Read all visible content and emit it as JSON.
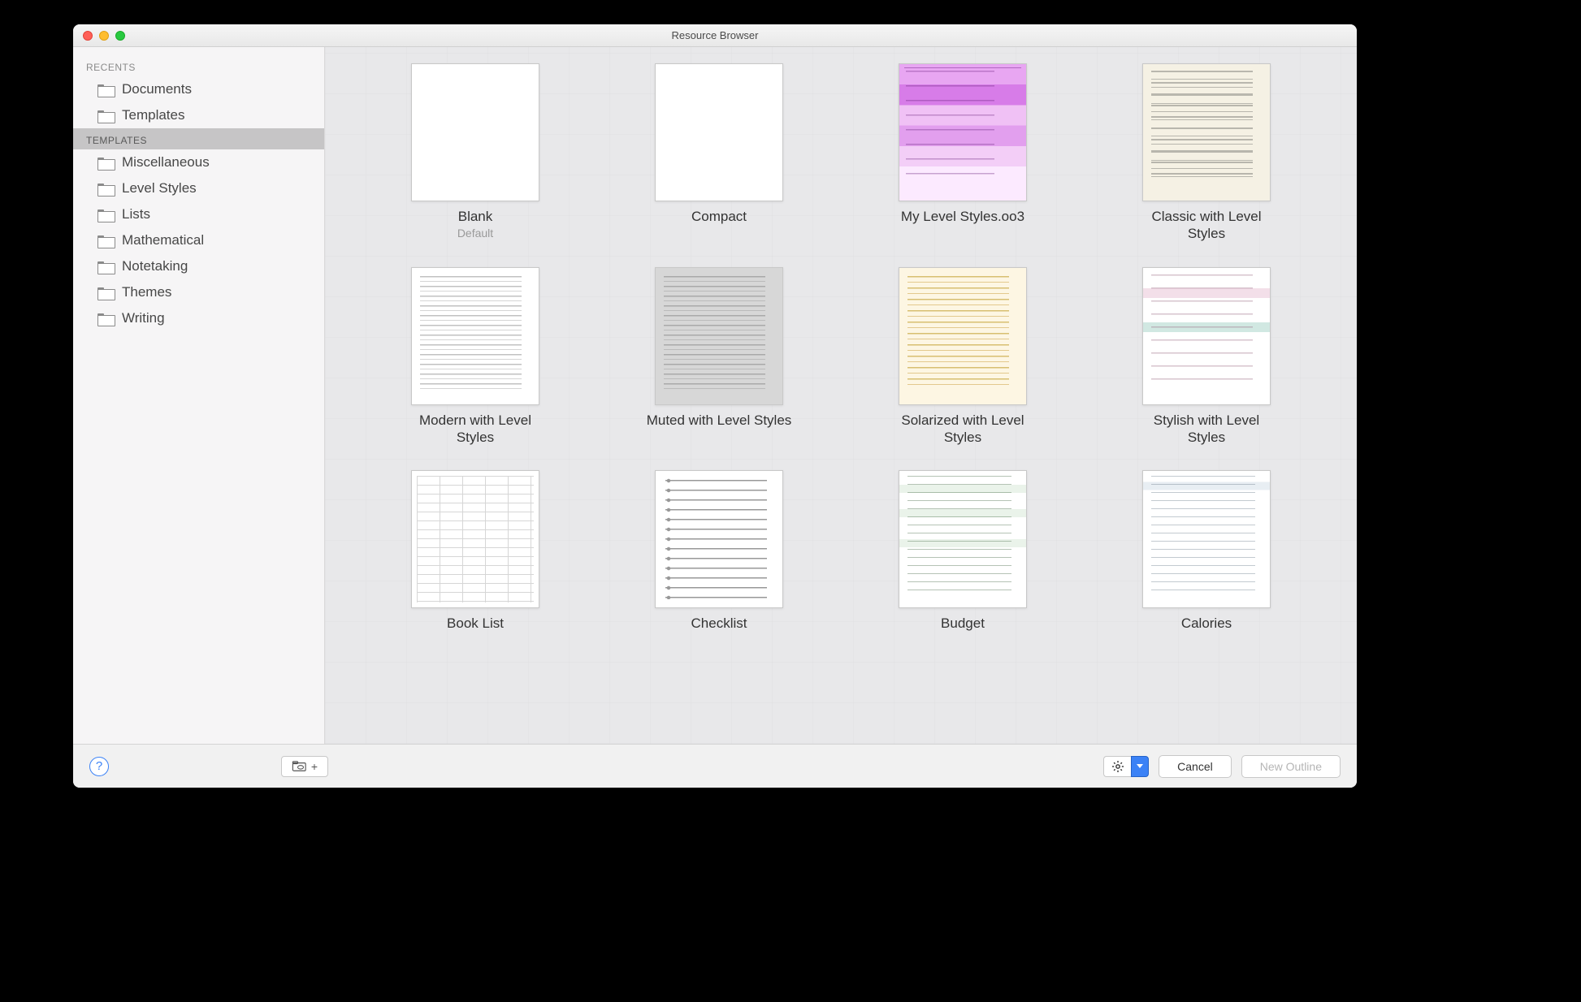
{
  "window": {
    "title": "Resource Browser"
  },
  "sidebar": {
    "recents_header": "RECENTS",
    "recents": [
      {
        "label": "Documents"
      },
      {
        "label": "Templates"
      }
    ],
    "templates_header": "TEMPLATES",
    "categories": [
      {
        "label": "Miscellaneous"
      },
      {
        "label": "Level Styles"
      },
      {
        "label": "Lists"
      },
      {
        "label": "Mathematical"
      },
      {
        "label": "Notetaking"
      },
      {
        "label": "Themes"
      },
      {
        "label": "Writing"
      }
    ]
  },
  "templates": [
    {
      "label": "Blank",
      "sub": "Default",
      "variant": "blank"
    },
    {
      "label": "Compact",
      "variant": "blank"
    },
    {
      "label": "My Level Styles.oo3",
      "variant": "pink"
    },
    {
      "label": "Classic with Level Styles",
      "variant": "beige"
    },
    {
      "label": "Modern with Level Styles",
      "variant": "outline"
    },
    {
      "label": "Muted with Level Styles",
      "variant": "muted"
    },
    {
      "label": "Solarized with Level Styles",
      "variant": "solarized"
    },
    {
      "label": "Stylish with Level Styles",
      "variant": "stylish"
    },
    {
      "label": "Book List",
      "variant": "table"
    },
    {
      "label": "Checklist",
      "variant": "checklist"
    },
    {
      "label": "Budget",
      "variant": "budget"
    },
    {
      "label": "Calories",
      "variant": "calories"
    }
  ],
  "toolbar": {
    "cancel": "Cancel",
    "new_outline": "New Outline"
  }
}
